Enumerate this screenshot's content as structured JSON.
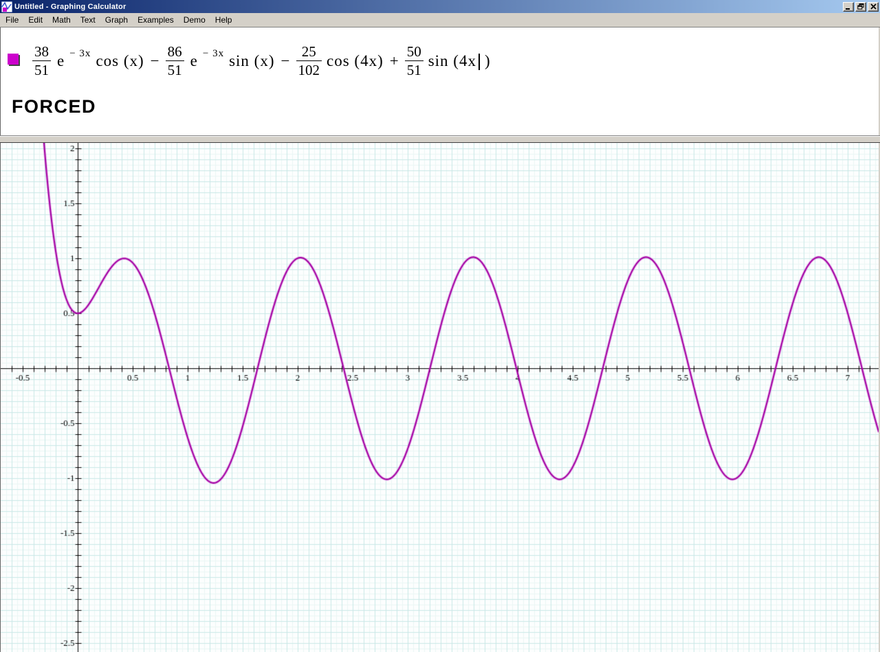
{
  "window": {
    "title": "Untitled - Graphing Calculator"
  },
  "menu": {
    "items": [
      "File",
      "Edit",
      "Math",
      "Text",
      "Graph",
      "Examples",
      "Demo",
      "Help"
    ]
  },
  "formula": {
    "swatch_color": "#cc00cc",
    "parts": [
      {
        "type": "frac",
        "num": "38",
        "den": "51"
      },
      {
        "type": "base",
        "text": "e"
      },
      {
        "type": "sup",
        "text": "− 3x"
      },
      {
        "type": "fn",
        "text": "cos (x)"
      },
      {
        "type": "op",
        "text": "−"
      },
      {
        "type": "frac",
        "num": "86",
        "den": "51"
      },
      {
        "type": "base",
        "text": "e"
      },
      {
        "type": "sup",
        "text": "− 3x"
      },
      {
        "type": "fn",
        "text": "sin (x)"
      },
      {
        "type": "op",
        "text": "−"
      },
      {
        "type": "frac",
        "num": "25",
        "den": "102"
      },
      {
        "type": "fn",
        "text": "cos (4x)"
      },
      {
        "type": "op",
        "text": "+"
      },
      {
        "type": "frac",
        "num": "50",
        "den": "51"
      },
      {
        "type": "fn",
        "text": "sin (4x"
      },
      {
        "type": "caret"
      },
      {
        "type": "fn",
        "text": ")"
      }
    ]
  },
  "annotation": {
    "text": "FORCED"
  },
  "chart_data": {
    "type": "line",
    "title": "",
    "expression": "f(x) = (38/51)e^(-3x)cos(x) - (86/51)e^(-3x)sin(x) - (25/102)cos(4x) + (50/51)sin(4x)",
    "terms": [
      {
        "sign": 1,
        "coef_num": 38,
        "coef_den": 51,
        "exp_coef": -3,
        "trig": "cos",
        "trig_coef": 1
      },
      {
        "sign": -1,
        "coef_num": 86,
        "coef_den": 51,
        "exp_coef": -3,
        "trig": "sin",
        "trig_coef": 1
      },
      {
        "sign": -1,
        "coef_num": 25,
        "coef_den": 102,
        "exp_coef": 0,
        "trig": "cos",
        "trig_coef": 4
      },
      {
        "sign": 1,
        "coef_num": 50,
        "coef_den": 51,
        "exp_coef": 0,
        "trig": "sin",
        "trig_coef": 4
      }
    ],
    "x_range": [
      -0.7,
      7.28125
    ],
    "y_range": [
      -2.58125,
      2.05
    ],
    "grid": true,
    "minor_grid_step": 0.05,
    "grid_step": 0.1,
    "tick_step": 0.1,
    "x_tick_labels": [
      {
        "v": -0.5,
        "t": "-0.5"
      },
      {
        "v": 0.5,
        "t": "0.5"
      },
      {
        "v": 1,
        "t": "1"
      },
      {
        "v": 1.5,
        "t": "1.5"
      },
      {
        "v": 2,
        "t": "2"
      },
      {
        "v": 2.5,
        "t": "2.5"
      },
      {
        "v": 3,
        "t": "3"
      },
      {
        "v": 3.5,
        "t": "3.5"
      },
      {
        "v": 4,
        "t": "4"
      },
      {
        "v": 4.5,
        "t": "4.5"
      },
      {
        "v": 5,
        "t": "5"
      },
      {
        "v": 5.5,
        "t": "5.5"
      },
      {
        "v": 6,
        "t": "6"
      },
      {
        "v": 6.5,
        "t": "6.5"
      },
      {
        "v": 7,
        "t": "7"
      }
    ],
    "y_tick_labels": [
      {
        "v": 2,
        "t": "2"
      },
      {
        "v": 1.5,
        "t": "1.5"
      },
      {
        "v": 1,
        "t": "1"
      },
      {
        "v": 0.5,
        "t": "0.5"
      },
      {
        "v": -0.5,
        "t": "-0.5"
      },
      {
        "v": -1,
        "t": "-1"
      },
      {
        "v": -1.5,
        "t": "-1.5"
      },
      {
        "v": -2,
        "t": "-2"
      },
      {
        "v": -2.5,
        "t": "-2.5"
      }
    ],
    "colors": {
      "curve": "#a000a0",
      "curve_halo": "rgba(204,0,204,0.30)",
      "axis": "#000000",
      "grid_major": "#c9e8e6",
      "grid_minor": "#eaf6f5",
      "background": "#fcfefe",
      "label": "#000000"
    },
    "legend": null
  }
}
